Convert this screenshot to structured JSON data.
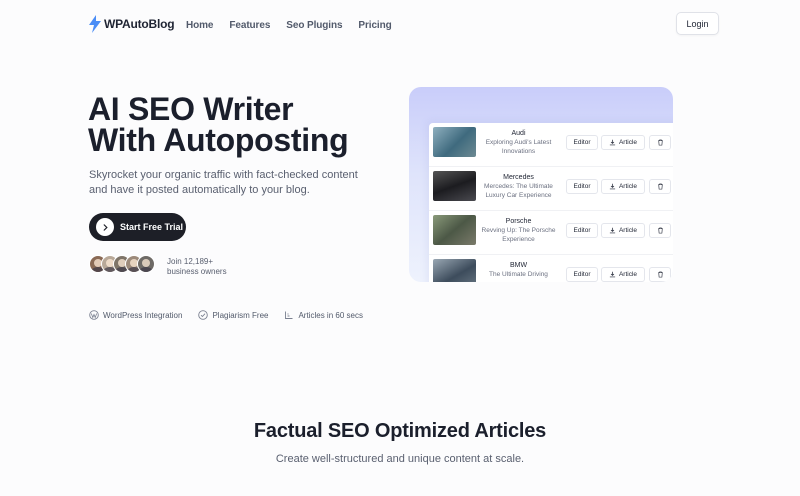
{
  "brand": {
    "name": "WPAutoBlog",
    "accent": "#3b82f6"
  },
  "nav": {
    "items": [
      "Home",
      "Features",
      "Seo Plugins",
      "Pricing"
    ],
    "login_label": "Login"
  },
  "hero": {
    "title_line1": "AI SEO Writer",
    "title_line2": "With Autoposting",
    "subtitle": "Skyrocket your organic traffic with fact-checked content and have it posted automatically to your blog.",
    "cta_label": "Start Free Trial",
    "social_proof": {
      "line1": "Join 12,189+",
      "line2": "business owners"
    },
    "features": [
      "WordPress Integration",
      "Plagiarism Free",
      "Articles in 60 secs"
    ]
  },
  "mockup": {
    "rows": [
      {
        "brand": "Audi",
        "title": "Exploring Audi's Latest Innovations",
        "thumb_color": "#4a7a8e"
      },
      {
        "brand": "Mercedes",
        "title": "Mercedes: The Ultimate Luxury Car Experience",
        "thumb_color": "#2e2e33"
      },
      {
        "brand": "Porsche",
        "title": "Revving Up: The Porsche Experience",
        "thumb_color": "#5c6a52"
      },
      {
        "brand": "BMW",
        "title": "The Ultimate Driving",
        "thumb_color": "#3d4c5c"
      }
    ],
    "editor_label": "Editor",
    "article_label": "Article"
  },
  "section2": {
    "title": "Factual SEO Optimized Articles",
    "subtitle": "Create well-structured and unique content at scale."
  }
}
